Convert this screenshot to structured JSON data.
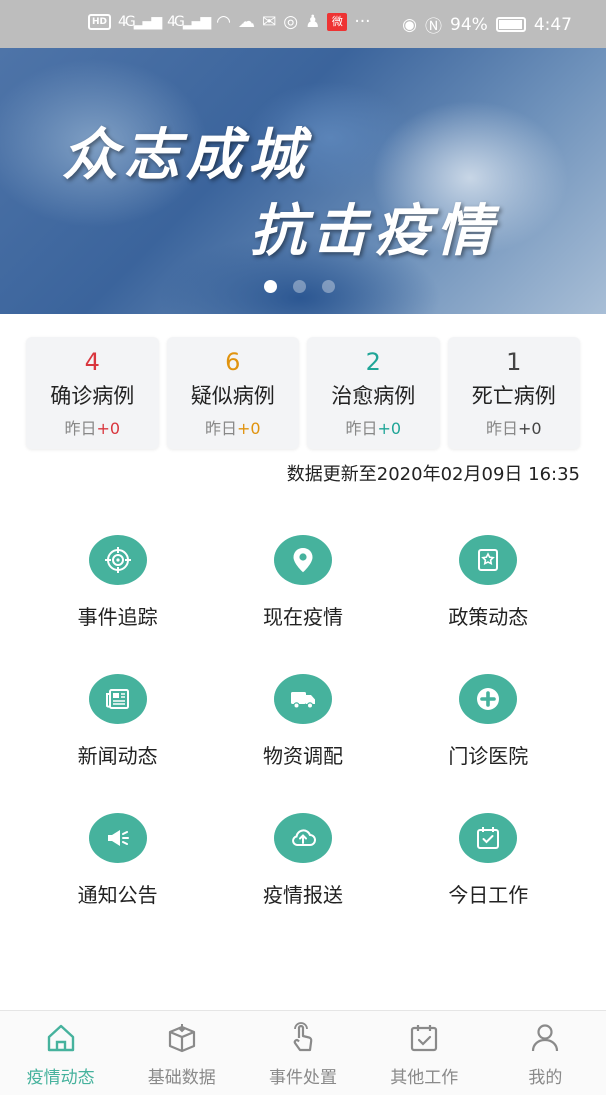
{
  "status_bar": {
    "battery_percent": "94%",
    "time": "4:47",
    "network_1": "4G",
    "network_2": "4G",
    "hd": "HD"
  },
  "banner": {
    "line1": "众志成城",
    "line2": "抗击疫情",
    "slide_count": 3,
    "active_slide": 0
  },
  "stats": [
    {
      "value": "4",
      "label": "确诊病例",
      "sub_prefix": "昨日",
      "delta": "+0",
      "value_color": "#d9363e",
      "delta_color": "#d9363e"
    },
    {
      "value": "6",
      "label": "疑似病例",
      "sub_prefix": "昨日",
      "delta": "+0",
      "value_color": "#e0930e",
      "delta_color": "#e0930e"
    },
    {
      "value": "2",
      "label": "治愈病例",
      "sub_prefix": "昨日",
      "delta": "+0",
      "value_color": "#1fa597",
      "delta_color": "#1fa597"
    },
    {
      "value": "1",
      "label": "死亡病例",
      "sub_prefix": "昨日",
      "delta": "+0",
      "value_color": "#444444",
      "delta_color": "#444444"
    }
  ],
  "update_text": "数据更新至2020年02月09日 16:35",
  "menu": [
    {
      "label": "事件追踪",
      "icon": "target-icon"
    },
    {
      "label": "现在疫情",
      "icon": "location-pin-icon"
    },
    {
      "label": "政策动态",
      "icon": "policy-badge-icon"
    },
    {
      "label": "新闻动态",
      "icon": "newspaper-icon"
    },
    {
      "label": "物资调配",
      "icon": "truck-icon"
    },
    {
      "label": "门诊医院",
      "icon": "medical-cross-icon"
    },
    {
      "label": "通知公告",
      "icon": "megaphone-icon"
    },
    {
      "label": "疫情报送",
      "icon": "cloud-upload-icon"
    },
    {
      "label": "今日工作",
      "icon": "calendar-check-icon"
    }
  ],
  "bottom_nav": [
    {
      "label": "疫情动态",
      "icon": "home-icon",
      "active": true
    },
    {
      "label": "基础数据",
      "icon": "box-icon",
      "active": false
    },
    {
      "label": "事件处置",
      "icon": "hand-tap-icon",
      "active": false
    },
    {
      "label": "其他工作",
      "icon": "calendar-icon",
      "active": false
    },
    {
      "label": "我的",
      "icon": "user-icon",
      "active": false
    }
  ],
  "colors": {
    "accent": "#46b29d",
    "nav_inactive": "#8a8a8a"
  }
}
